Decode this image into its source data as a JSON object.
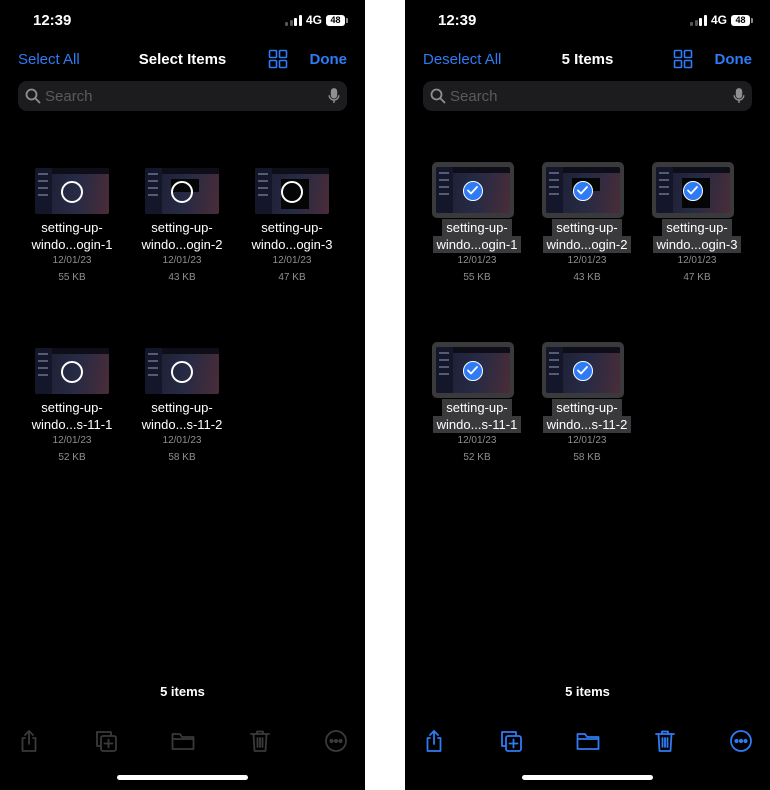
{
  "colors": {
    "accent": "#2f7bf5",
    "disabled": "#3a3a3c",
    "background": "#000000"
  },
  "status": {
    "time": "12:39",
    "network": "4G",
    "battery": "48"
  },
  "search": {
    "placeholder": "Search"
  },
  "left": {
    "nav": {
      "left_button": "Select All",
      "title": "Select Items",
      "done": "Done"
    },
    "item_count": "5 items",
    "files": [
      {
        "name_line1": "setting-up-",
        "name_line2": "windo...ogin-1",
        "date": "12/01/23",
        "size": "55 KB"
      },
      {
        "name_line1": "setting-up-",
        "name_line2": "windo...ogin-2",
        "date": "12/01/23",
        "size": "43 KB"
      },
      {
        "name_line1": "setting-up-",
        "name_line2": "windo...ogin-3",
        "date": "12/01/23",
        "size": "47 KB"
      },
      {
        "name_line1": "setting-up-",
        "name_line2": "windo...s-11-1",
        "date": "12/01/23",
        "size": "52 KB"
      },
      {
        "name_line1": "setting-up-",
        "name_line2": "windo...s-11-2",
        "date": "12/01/23",
        "size": "58 KB"
      }
    ]
  },
  "right": {
    "nav": {
      "left_button": "Deselect All",
      "title": "5 Items",
      "done": "Done"
    },
    "item_count": "5 items",
    "files": [
      {
        "name_line1": "setting-up-",
        "name_line2": "windo...ogin-1",
        "date": "12/01/23",
        "size": "55 KB",
        "selected": true
      },
      {
        "name_line1": "setting-up-",
        "name_line2": "windo...ogin-2",
        "date": "12/01/23",
        "size": "43 KB",
        "selected": true
      },
      {
        "name_line1": "setting-up-",
        "name_line2": "windo...ogin-3",
        "date": "12/01/23",
        "size": "47 KB",
        "selected": true
      },
      {
        "name_line1": "setting-up-",
        "name_line2": "windo...s-11-1",
        "date": "12/01/23",
        "size": "52 KB",
        "selected": true
      },
      {
        "name_line1": "setting-up-",
        "name_line2": "windo...s-11-2",
        "date": "12/01/23",
        "size": "58 KB",
        "selected": true
      }
    ]
  },
  "toolbar_icons": [
    "share-icon",
    "duplicate-icon",
    "folder-icon",
    "trash-icon",
    "more-icon"
  ]
}
